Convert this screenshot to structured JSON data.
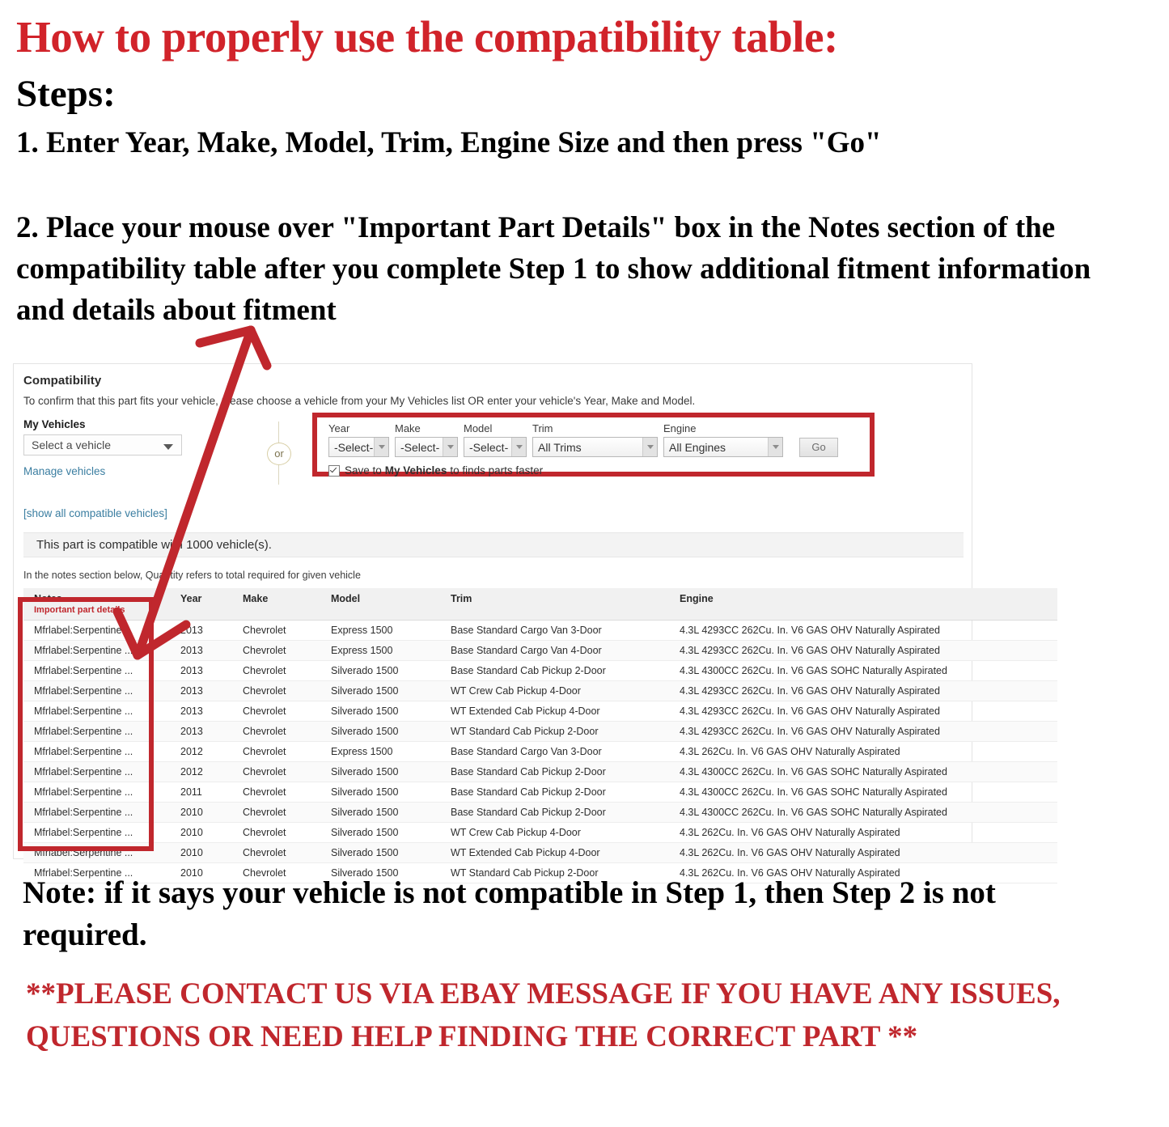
{
  "headline": "How to properly use the compatibility table:",
  "steps_label": "Steps:",
  "step1": "1. Enter Year, Make, Model, Trim, Engine Size and then press \"Go\"",
  "step2": "2. Place your mouse over \"Important Part Details\" box in the Notes section of the compatibility table after you complete Step 1 to show additional fitment information and details about fitment",
  "note_bottom": "Note: if it says your vehicle is not compatible in Step 1, then Step 2 is not required.",
  "contact_note": "**PLEASE CONTACT US VIA EBAY MESSAGE IF YOU HAVE ANY ISSUES, QUESTIONS OR NEED HELP FINDING THE CORRECT PART **",
  "colors": {
    "brand_red": "#c0272d",
    "headline_red": "#d1232a",
    "link_blue": "#3b7ea1",
    "banner_gray": "#f3f3f3"
  },
  "panel": {
    "title": "Compatibility",
    "subtitle": "To confirm that this part fits your vehicle, please choose a vehicle from your My Vehicles list OR enter your vehicle's Year, Make and Model.",
    "my_vehicles": {
      "label": "My Vehicles",
      "select_value": "Select a vehicle",
      "manage_link": "Manage vehicles"
    },
    "or_separator": "or",
    "ymm": {
      "year": {
        "label": "Year",
        "value": "-Select-"
      },
      "make": {
        "label": "Make",
        "value": "-Select-"
      },
      "model": {
        "label": "Model",
        "value": "-Select-"
      },
      "trim": {
        "label": "Trim",
        "value": "All Trims"
      },
      "engine": {
        "label": "Engine",
        "value": "All Engines"
      },
      "go_button": "Go"
    },
    "save_checkbox": {
      "checked": true,
      "text_before": "Save to",
      "text_bold": "My Vehicles",
      "text_after": "to finds parts faster"
    },
    "show_all_link": "[show all compatible vehicles]",
    "compat_banner": "This part is compatible with 1000 vehicle(s).",
    "notes_hint": "In the notes section below, Quantity refers to total required for given vehicle"
  },
  "table": {
    "headers": {
      "notes": "Notes",
      "notes_sub": "Important part details",
      "year": "Year",
      "make": "Make",
      "model": "Model",
      "trim": "Trim",
      "engine": "Engine"
    },
    "rows": [
      {
        "notes": "Mfrlabel:Serpentine ...",
        "year": "2013",
        "make": "Chevrolet",
        "model": "Express 1500",
        "trim": "Base Standard Cargo Van 3-Door",
        "engine": "4.3L 4293CC 262Cu. In. V6 GAS OHV Naturally Aspirated"
      },
      {
        "notes": "Mfrlabel:Serpentine ...",
        "year": "2013",
        "make": "Chevrolet",
        "model": "Express 1500",
        "trim": "Base Standard Cargo Van 4-Door",
        "engine": "4.3L 4293CC 262Cu. In. V6 GAS OHV Naturally Aspirated"
      },
      {
        "notes": "Mfrlabel:Serpentine ...",
        "year": "2013",
        "make": "Chevrolet",
        "model": "Silverado 1500",
        "trim": "Base Standard Cab Pickup 2-Door",
        "engine": "4.3L 4300CC 262Cu. In. V6 GAS SOHC Naturally Aspirated"
      },
      {
        "notes": "Mfrlabel:Serpentine ...",
        "year": "2013",
        "make": "Chevrolet",
        "model": "Silverado 1500",
        "trim": "WT Crew Cab Pickup 4-Door",
        "engine": "4.3L 4293CC 262Cu. In. V6 GAS OHV Naturally Aspirated"
      },
      {
        "notes": "Mfrlabel:Serpentine ...",
        "year": "2013",
        "make": "Chevrolet",
        "model": "Silverado 1500",
        "trim": "WT Extended Cab Pickup 4-Door",
        "engine": "4.3L 4293CC 262Cu. In. V6 GAS OHV Naturally Aspirated"
      },
      {
        "notes": "Mfrlabel:Serpentine ...",
        "year": "2013",
        "make": "Chevrolet",
        "model": "Silverado 1500",
        "trim": "WT Standard Cab Pickup 2-Door",
        "engine": "4.3L 4293CC 262Cu. In. V6 GAS OHV Naturally Aspirated"
      },
      {
        "notes": "Mfrlabel:Serpentine ...",
        "year": "2012",
        "make": "Chevrolet",
        "model": "Express 1500",
        "trim": "Base Standard Cargo Van 3-Door",
        "engine": "4.3L 262Cu. In. V6 GAS OHV Naturally Aspirated"
      },
      {
        "notes": "Mfrlabel:Serpentine ...",
        "year": "2012",
        "make": "Chevrolet",
        "model": "Silverado 1500",
        "trim": "Base Standard Cab Pickup 2-Door",
        "engine": "4.3L 4300CC 262Cu. In. V6 GAS SOHC Naturally Aspirated"
      },
      {
        "notes": "Mfrlabel:Serpentine ...",
        "year": "2011",
        "make": "Chevrolet",
        "model": "Silverado 1500",
        "trim": "Base Standard Cab Pickup 2-Door",
        "engine": "4.3L 4300CC 262Cu. In. V6 GAS SOHC Naturally Aspirated"
      },
      {
        "notes": "Mfrlabel:Serpentine ...",
        "year": "2010",
        "make": "Chevrolet",
        "model": "Silverado 1500",
        "trim": "Base Standard Cab Pickup 2-Door",
        "engine": "4.3L 4300CC 262Cu. In. V6 GAS SOHC Naturally Aspirated"
      },
      {
        "notes": "Mfrlabel:Serpentine ...",
        "year": "2010",
        "make": "Chevrolet",
        "model": "Silverado 1500",
        "trim": "WT Crew Cab Pickup 4-Door",
        "engine": "4.3L 262Cu. In. V6 GAS OHV Naturally Aspirated"
      },
      {
        "notes": "Mfrlabel:Serpentine ...",
        "year": "2010",
        "make": "Chevrolet",
        "model": "Silverado 1500",
        "trim": "WT Extended Cab Pickup 4-Door",
        "engine": "4.3L 262Cu. In. V6 GAS OHV Naturally Aspirated"
      },
      {
        "notes": "Mfrlabel:Serpentine ...",
        "year": "2010",
        "make": "Chevrolet",
        "model": "Silverado 1500",
        "trim": "WT Standard Cab Pickup 2-Door",
        "engine": "4.3L 262Cu. In. V6 GAS OHV Naturally Aspirated"
      }
    ]
  }
}
